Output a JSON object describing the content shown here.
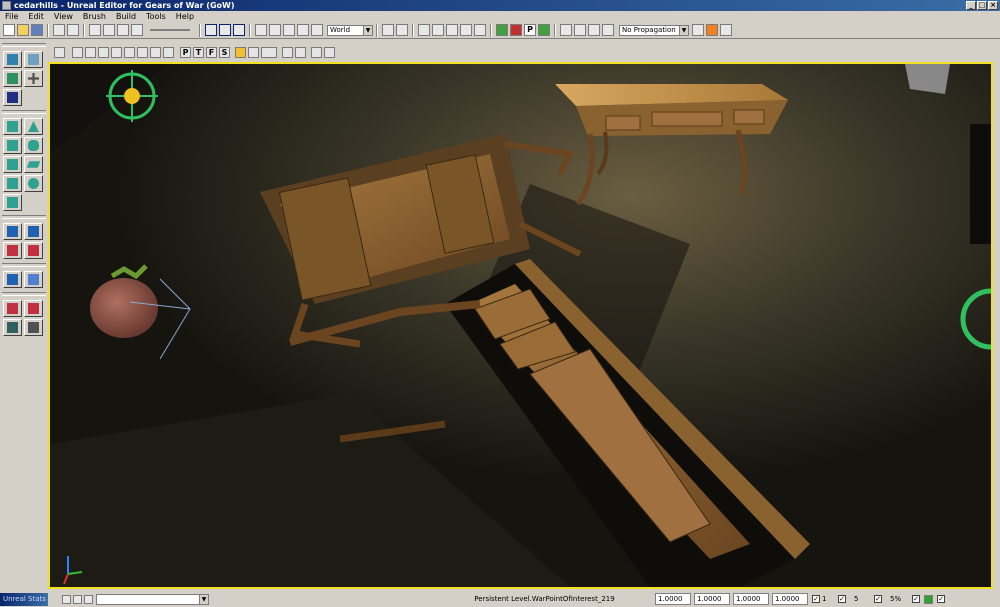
{
  "window": {
    "title": "cedarhills - Unreal Editor for Gears of War (GoW)"
  },
  "menu": [
    "File",
    "Edit",
    "View",
    "Brush",
    "Build",
    "Tools",
    "Help"
  ],
  "toolbar": {
    "coord_system": "World",
    "propagation": "No Propagation"
  },
  "viewport_toolbar": {
    "p": "P",
    "t": "T",
    "f": "F",
    "s": "S"
  },
  "status": {
    "panel_title": "Unreal Stats",
    "selection": "Persistent Level.WarPointOfInterest_219",
    "drag_x": "1.0000",
    "drag_y": "1.0000",
    "drag_z": "1.0000",
    "drag_w": "1.0000",
    "grid": "1",
    "rot_snap": "5",
    "scale_snap": "5%"
  },
  "colors": {
    "viewport_border": "#f0e020",
    "titlebar": "#0a246a"
  }
}
